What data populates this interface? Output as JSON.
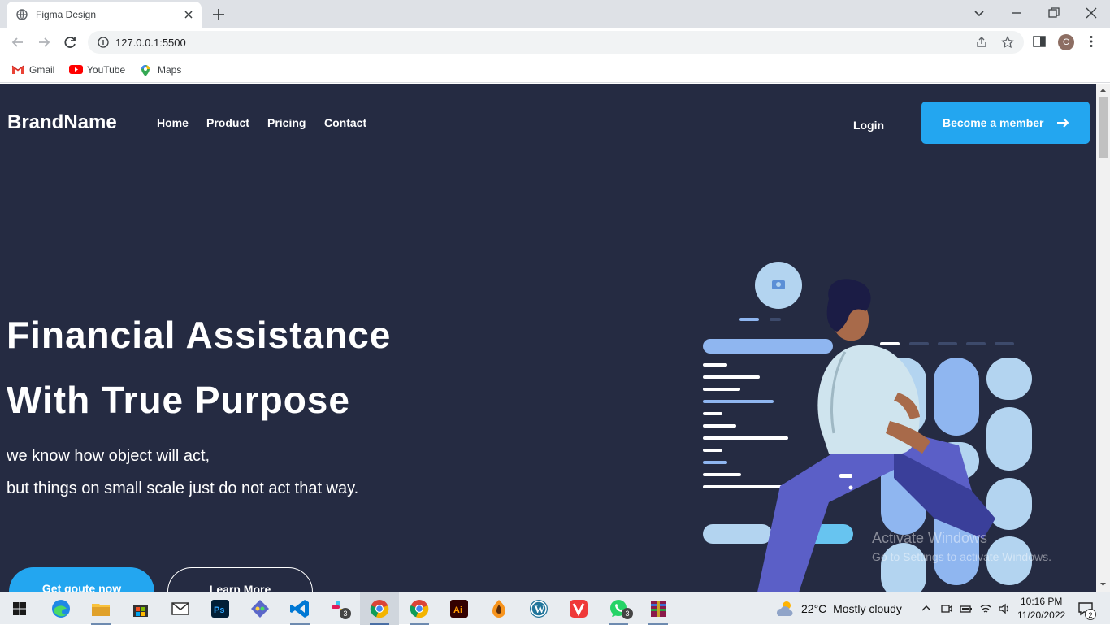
{
  "browser": {
    "tab_title": "Figma Design",
    "url": "127.0.0.1:5500",
    "profile_initial": "C",
    "bookmarks": [
      {
        "label": "Gmail",
        "icon": "gmail-icon"
      },
      {
        "label": "YouTube",
        "icon": "youtube-icon"
      },
      {
        "label": "Maps",
        "icon": "maps-icon"
      }
    ]
  },
  "header": {
    "brand": "BrandName",
    "nav": [
      "Home",
      "Product",
      "Pricing",
      "Contact"
    ],
    "login": "Login",
    "cta": "Become a member"
  },
  "hero": {
    "title_line1": "Financial Assistance",
    "title_line2": "With True Purpose",
    "sub_line1": "we know how object will act,",
    "sub_line2": "but things on small scale just do not act that way.",
    "btn_primary": "Get qoute now",
    "btn_secondary": "Learn More"
  },
  "watermark": {
    "line1": "Activate Windows",
    "line2": "Go to Settings to activate Windows."
  },
  "taskbar": {
    "weather_temp": "22°C",
    "weather_desc": "Mostly cloudy",
    "time": "10:16 PM",
    "date": "11/20/2022",
    "notification_count": "2",
    "badges": {
      "slack": "3",
      "whatsapp": "3"
    }
  },
  "colors": {
    "page_bg": "#252b42",
    "accent": "#23a6f0",
    "text": "#ffffff"
  }
}
